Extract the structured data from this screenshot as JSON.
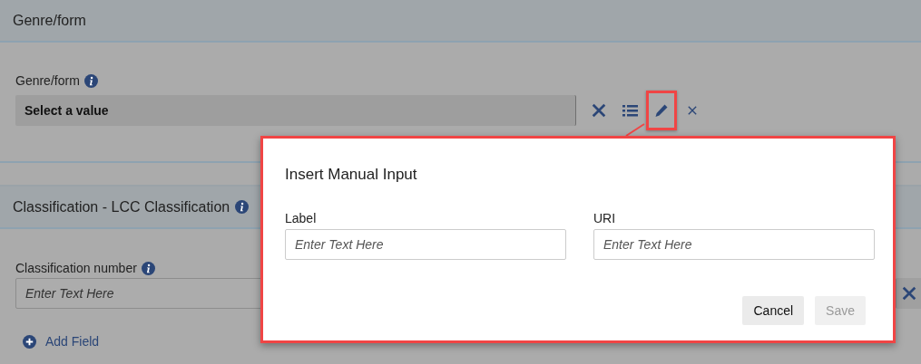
{
  "sections": [
    {
      "title": "Genre/form",
      "info": false,
      "fields": [
        {
          "kind": "lookup",
          "label": "Genre/form",
          "info": true,
          "value": "Select a value",
          "edit_highlighted": true
        }
      ]
    },
    {
      "title": "Classification - LCC Classification",
      "info": true,
      "fields": [
        {
          "kind": "text",
          "label": "Classification number",
          "info": true,
          "placeholder": "Enter Text Here"
        }
      ],
      "add_field": "Add Field"
    }
  ],
  "dialog": {
    "title": "Insert Manual Input",
    "fields": [
      {
        "label": "Label",
        "placeholder": "Enter Text Here"
      },
      {
        "label": "URI",
        "placeholder": "Enter Text Here"
      }
    ],
    "buttons": [
      {
        "label": "Cancel",
        "disabled": false
      },
      {
        "label": "Save",
        "disabled": true
      }
    ]
  }
}
